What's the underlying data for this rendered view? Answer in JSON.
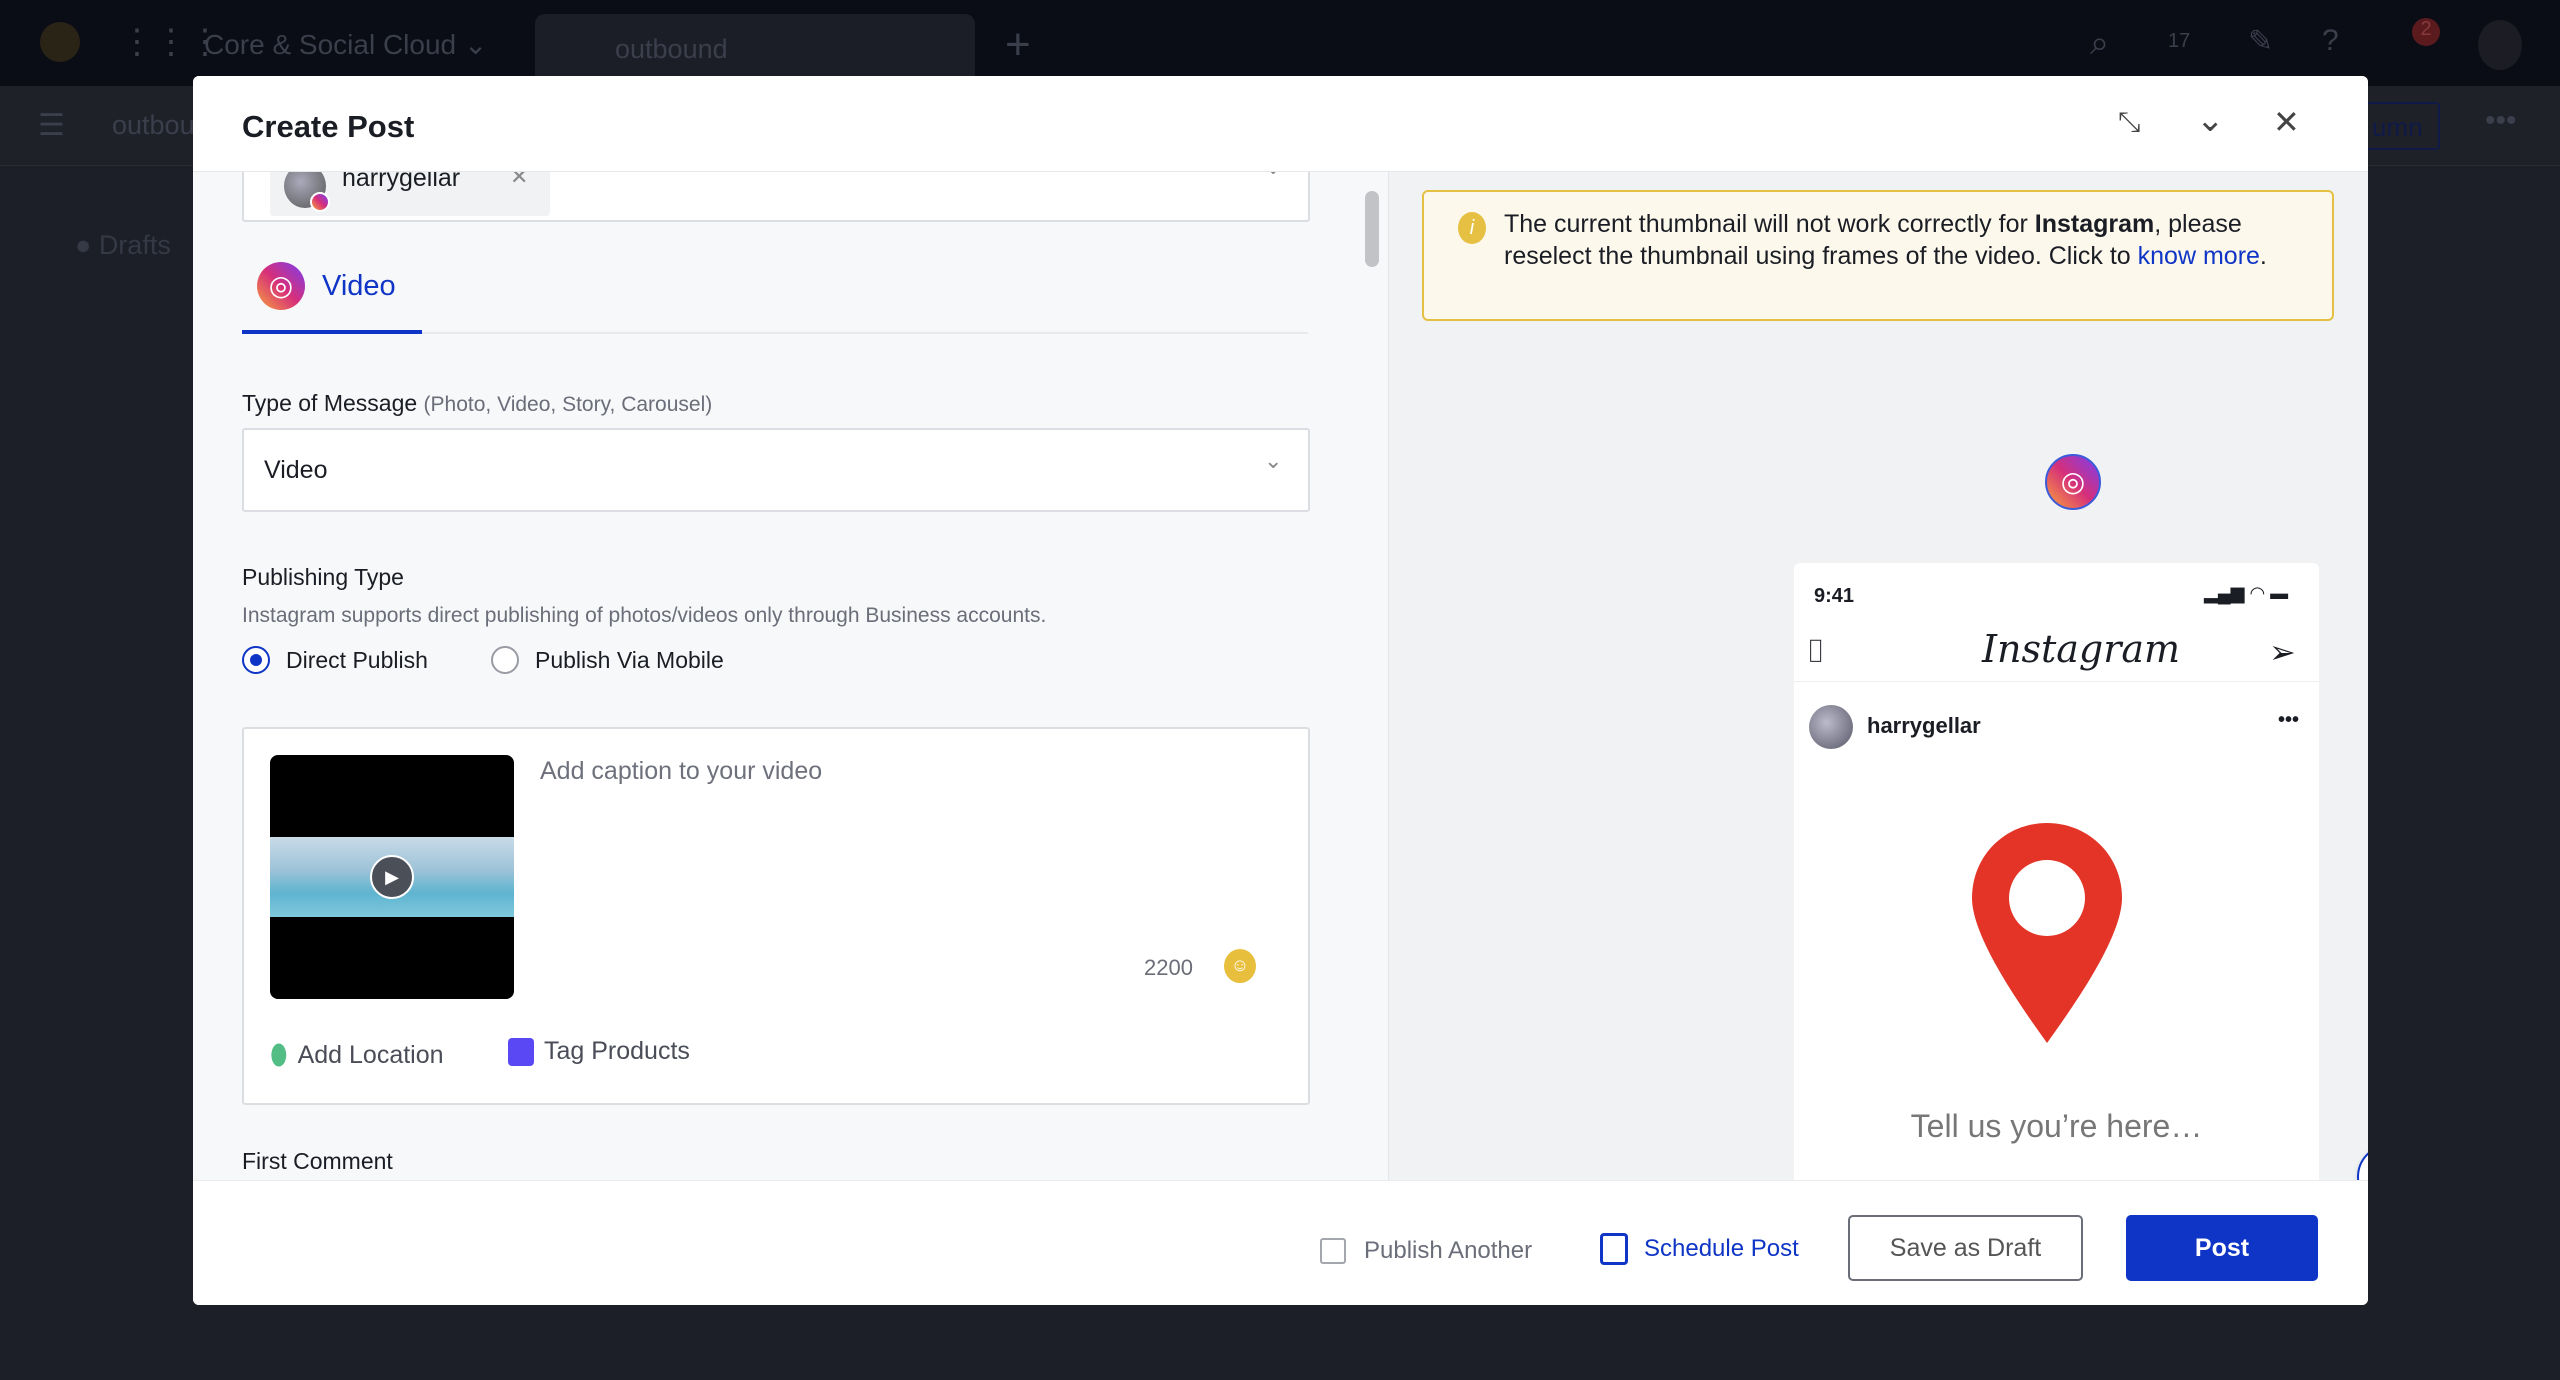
{
  "app": {
    "workspace": "Core & Social Cloud",
    "tab": "outbound",
    "subbar_title": "outbound",
    "sidebar_label": "Drafts",
    "column_button": "umn",
    "notification_count": "2",
    "calendar_day": "17"
  },
  "modal": {
    "title": "Create Post",
    "account": {
      "name": "harrygellar"
    },
    "tabs": [
      {
        "label": "Video",
        "active": true
      }
    ],
    "type_of_message": {
      "label": "Type of Message",
      "hint": "(Photo, Video, Story, Carousel)",
      "value": "Video"
    },
    "publishing_type": {
      "label": "Publishing Type",
      "description": "Instagram supports direct publishing of photos/videos only through Business accounts.",
      "options": [
        {
          "label": "Direct Publish",
          "selected": true
        },
        {
          "label": "Publish Via Mobile",
          "selected": false
        }
      ]
    },
    "caption": {
      "placeholder": "Add caption to your video",
      "char_count": "2200",
      "add_location": "Add Location",
      "tag_products": "Tag Products"
    },
    "first_comment_label": "First Comment",
    "warning": {
      "text_before": "The current thumbnail will not work correctly for ",
      "bold": "Instagram",
      "text_after": ", please reselect the thumbnail using frames of the video. Click to ",
      "link": "know more",
      "end": "."
    },
    "preview": {
      "time": "9:41",
      "brand": "Instagram",
      "username": "harrygellar",
      "media_text": "Tell us you’re here…",
      "view_modes": [
        "mobile",
        "desktop"
      ],
      "active_view": "mobile"
    },
    "footer": {
      "publish_another": "Publish Another",
      "publish_another_checked": false,
      "schedule": "Schedule Post",
      "draft": "Save as Draft",
      "post": "Post"
    }
  },
  "colors": {
    "accent": "#0f35c6",
    "warning_border": "#e6c042",
    "warning_bg": "#fcf8ec",
    "pin": "#e33427"
  }
}
